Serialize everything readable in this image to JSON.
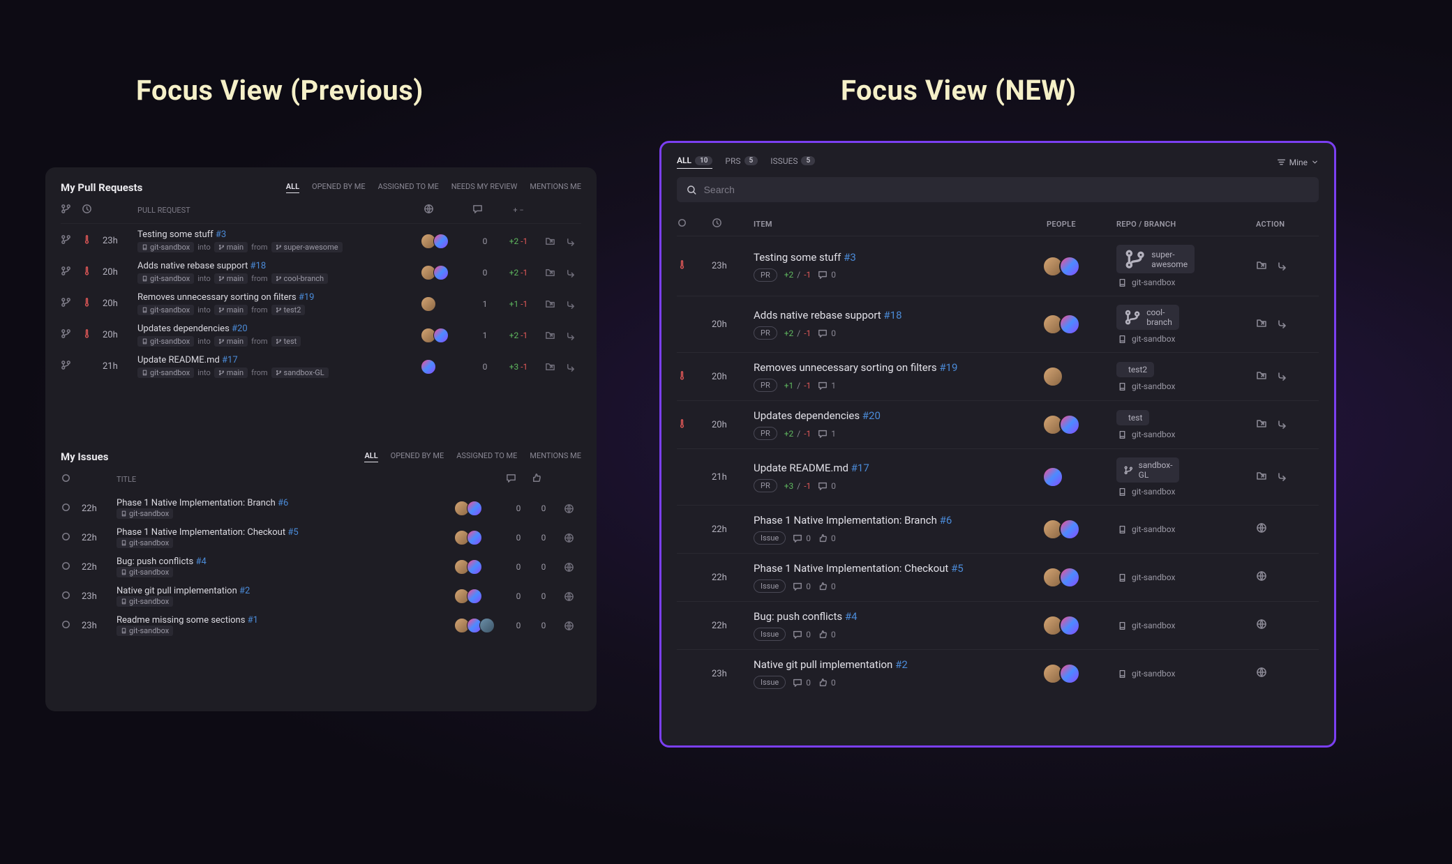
{
  "titles": {
    "left": "Focus View (Previous)",
    "right": "Focus View (NEW)"
  },
  "left": {
    "pr_section_title": "My Pull Requests",
    "issue_section_title": "My Issues",
    "pr_filters": [
      "ALL",
      "OPENED BY ME",
      "ASSIGNED TO ME",
      "NEEDS MY REVIEW",
      "MENTIONS ME"
    ],
    "issue_filters": [
      "ALL",
      "OPENED BY ME",
      "ASSIGNED TO ME",
      "MENTIONS ME"
    ],
    "pr_col": "PULL REQUEST",
    "title_col": "TITLE",
    "repo_label": "git-sandbox",
    "into": "into",
    "from": "from",
    "main": "main",
    "prs": [
      {
        "time": "23h",
        "title": "Testing some stuff",
        "num": "#3",
        "branch": "super-awesome",
        "hot": true,
        "av": 2,
        "c": "0",
        "diff_p": "+2",
        "diff_m": "-1"
      },
      {
        "time": "20h",
        "title": "Adds native rebase support",
        "num": "#18",
        "branch": "cool-branch",
        "hot": true,
        "av": 2,
        "c": "0",
        "diff_p": "+2",
        "diff_m": "-1"
      },
      {
        "time": "20h",
        "title": "Removes unnecessary sorting on filters",
        "num": "#19",
        "branch": "test2",
        "hot": true,
        "av": 1,
        "c": "1",
        "diff_p": "+1",
        "diff_m": "-1"
      },
      {
        "time": "20h",
        "title": "Updates dependencies",
        "num": "#20",
        "branch": "test",
        "hot": true,
        "av": 2,
        "c": "1",
        "diff_p": "+2",
        "diff_m": "-1"
      },
      {
        "time": "21h",
        "title": "Update README.md",
        "num": "#17",
        "branch": "sandbox-GL",
        "hot": false,
        "av": 1,
        "av2only": true,
        "c": "0",
        "diff_p": "+3",
        "diff_m": "-1"
      }
    ],
    "issues": [
      {
        "time": "22h",
        "title": "Phase 1 Native Implementation: Branch",
        "num": "#6",
        "av": 2,
        "c1": "0",
        "c2": "0"
      },
      {
        "time": "22h",
        "title": "Phase 1 Native Implementation: Checkout",
        "num": "#5",
        "av": 2,
        "c1": "0",
        "c2": "0"
      },
      {
        "time": "22h",
        "title": "Bug: push conflicts",
        "num": "#4",
        "av": 2,
        "c1": "0",
        "c2": "0"
      },
      {
        "time": "23h",
        "title": "Native git pull implementation",
        "num": "#2",
        "av": 2,
        "c1": "0",
        "c2": "0"
      },
      {
        "time": "23h",
        "title": "Readme missing some sections",
        "num": "#1",
        "av": 3,
        "c1": "0",
        "c2": "0"
      }
    ]
  },
  "right": {
    "tabs": {
      "all": "ALL",
      "all_n": "10",
      "prs": "PRS",
      "prs_n": "5",
      "issues": "ISSUES",
      "issues_n": "5"
    },
    "mine": "Mine",
    "search_placeholder": "Search",
    "cols": {
      "item": "ITEM",
      "people": "PEOPLE",
      "repo": "REPO / BRANCH",
      "action": "ACTION"
    },
    "repo": "git-sandbox",
    "rows": [
      {
        "hot": true,
        "time": "23h",
        "title": "Testing some stuff",
        "num": "#3",
        "type": "PR",
        "p": "+2",
        "m": "-1",
        "c": "0",
        "branch": "super-awesome",
        "av": 2,
        "folder": true
      },
      {
        "hot": false,
        "time": "20h",
        "title": "Adds native rebase support",
        "num": "#18",
        "type": "PR",
        "p": "+2",
        "m": "-1",
        "c": "0",
        "branch": "cool-branch",
        "av": 2,
        "folder": true
      },
      {
        "hot": true,
        "time": "20h",
        "title": "Removes unnecessary sorting on filters",
        "num": "#19",
        "type": "PR",
        "p": "+1",
        "m": "-1",
        "c": "1",
        "branch": "test2",
        "av": 1,
        "folder": true
      },
      {
        "hot": true,
        "time": "20h",
        "title": "Updates dependencies",
        "num": "#20",
        "type": "PR",
        "p": "+2",
        "m": "-1",
        "c": "1",
        "branch": "test",
        "av": 2,
        "folder": true
      },
      {
        "hot": false,
        "time": "21h",
        "title": "Update README.md",
        "num": "#17",
        "type": "PR",
        "p": "+3",
        "m": "-1",
        "c": "0",
        "branch": "sandbox-GL",
        "av": 1,
        "av2only": true,
        "folder": true
      },
      {
        "hot": false,
        "time": "22h",
        "title": "Phase 1 Native Implementation: Branch",
        "num": "#6",
        "type": "Issue",
        "c": "0",
        "t": "0",
        "av": 2,
        "globe": true
      },
      {
        "hot": false,
        "time": "22h",
        "title": "Phase 1 Native Implementation: Checkout",
        "num": "#5",
        "type": "Issue",
        "c": "0",
        "t": "0",
        "av": 2,
        "globe": true
      },
      {
        "hot": false,
        "time": "22h",
        "title": "Bug: push conflicts",
        "num": "#4",
        "type": "Issue",
        "c": "0",
        "t": "0",
        "av": 2,
        "globe": true
      },
      {
        "hot": false,
        "time": "23h",
        "title": "Native git pull implementation",
        "num": "#2",
        "type": "Issue",
        "c": "0",
        "t": "0",
        "av": 2,
        "globe": true
      }
    ]
  }
}
